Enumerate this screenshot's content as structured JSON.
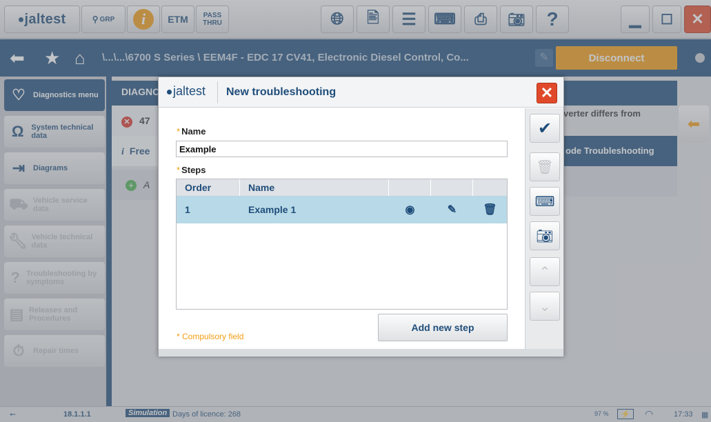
{
  "toolbar": {
    "logo": "jaltest",
    "grp_label": "GRP",
    "info_icon": "i",
    "etm_label": "ETM",
    "pass_label": "PASS",
    "thru_label": "THRU",
    "help_label": "?"
  },
  "nav": {
    "path": "\\...\\...\\6700 S Series \\ EEM4F - EDC 17 CV41, Electronic Diesel Control, Co...",
    "disconnect_label": "Disconnect"
  },
  "sidebar": {
    "items": [
      {
        "label": "Diagnostics menu",
        "icon": "stethoscope-icon",
        "state": "active"
      },
      {
        "label": "System technical data",
        "icon": "omega-icon",
        "state": "normal"
      },
      {
        "label": "Diagrams",
        "icon": "diagram-icon",
        "state": "normal"
      },
      {
        "label": "Vehicle service data",
        "icon": "vehicle-icon",
        "state": "disabled"
      },
      {
        "label": "Vehicle technical data",
        "icon": "wrench-icon",
        "state": "disabled"
      },
      {
        "label": "Troubleshooting by symptoms",
        "icon": "question-wrench-icon",
        "state": "disabled"
      },
      {
        "label": "Releases and Procedures",
        "icon": "procedure-icon",
        "state": "disabled"
      },
      {
        "label": "Repair times",
        "icon": "timer-icon",
        "state": "disabled"
      }
    ]
  },
  "background": {
    "header": "DIAGNO",
    "row1_code": "47",
    "row2_label": "Free",
    "row3_label": "A",
    "right_text1": "verter differs from",
    "right_text2": "ode Troubleshooting"
  },
  "modal": {
    "logo": "jaltest",
    "title": "New troubleshooting",
    "name_label": "Name",
    "name_value": "Example",
    "steps_label": "Steps",
    "columns": [
      "Order",
      "Name",
      "",
      "",
      ""
    ],
    "steps": [
      {
        "order": "1",
        "name": "Example 1"
      }
    ],
    "compulsory_note": "* Compulsory field",
    "add_step_label": "Add new step"
  },
  "status": {
    "version": "18.1.1.1",
    "mode": "Simulation",
    "licence": "Days of licence: 268",
    "battery": "97 %",
    "time": "17:33"
  },
  "colors": {
    "primary": "#1f4d7a",
    "accent": "#f39c12",
    "close": "#e04a2a",
    "row_selected": "#b8d9e7"
  }
}
